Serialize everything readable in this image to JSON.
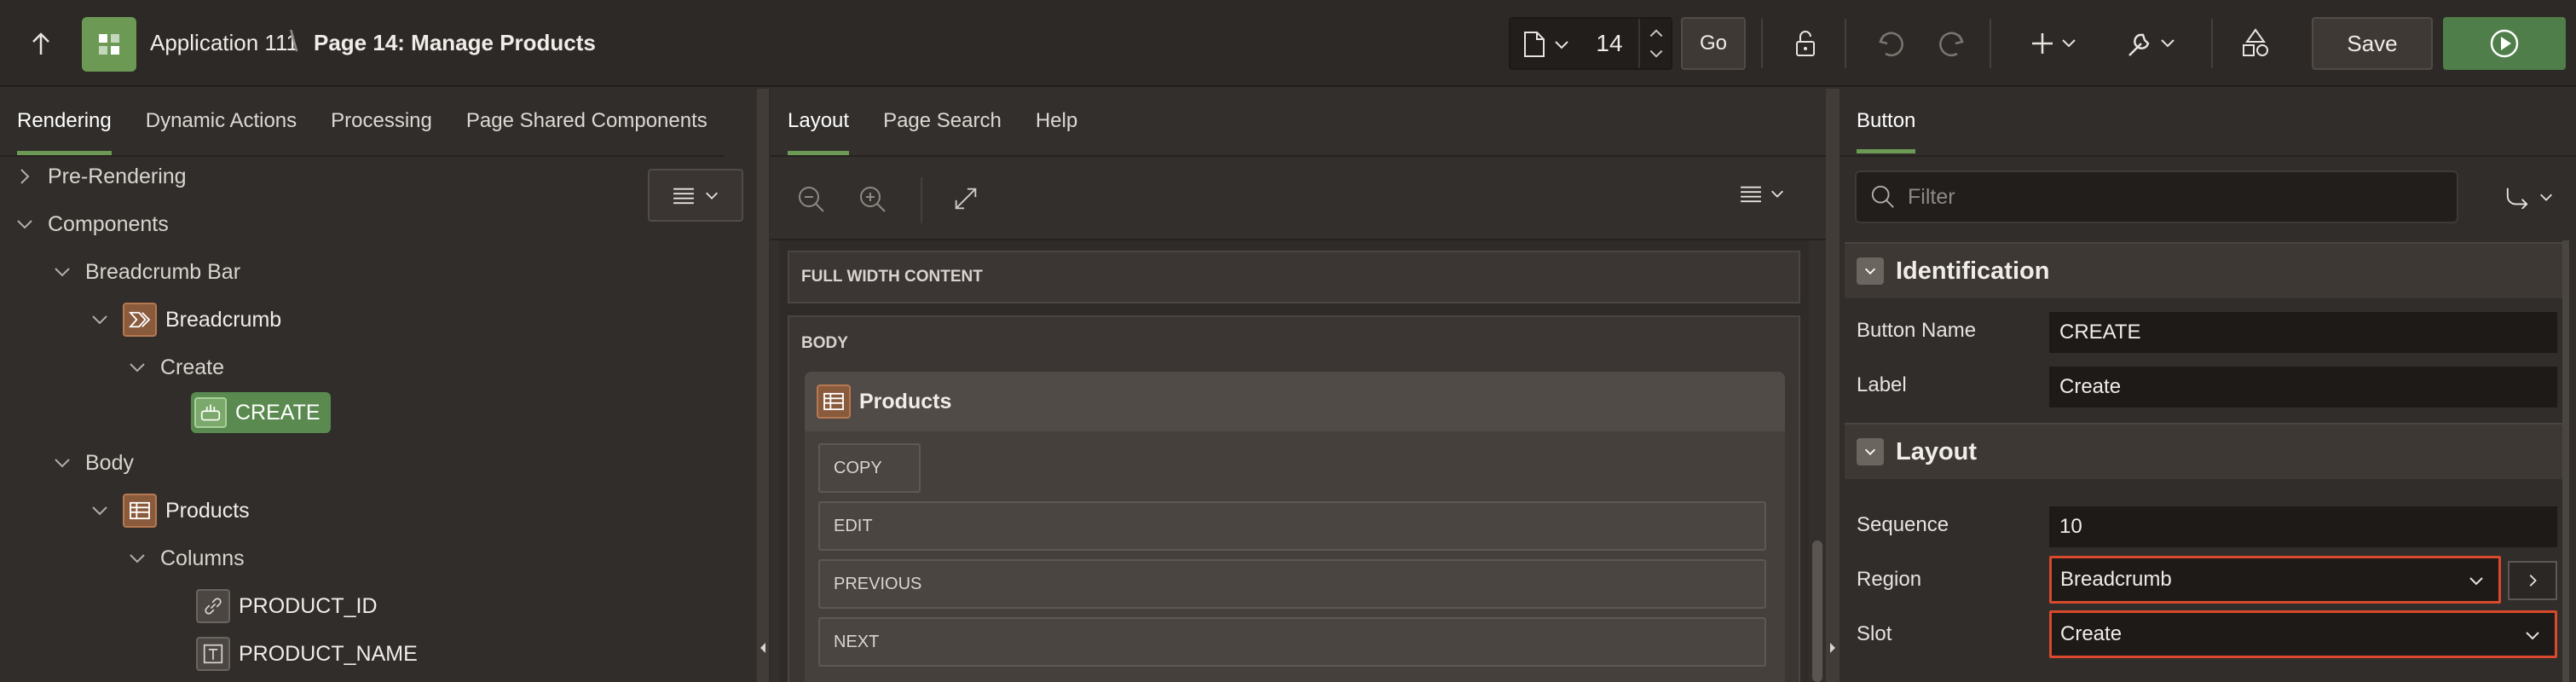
{
  "header": {
    "app_name": "Application 111",
    "separator": "\\",
    "page_title": "Page 14: Manage Products",
    "page_number": "14",
    "go_label": "Go",
    "save_label": "Save"
  },
  "left_panel": {
    "tabs": [
      "Rendering",
      "Dynamic Actions",
      "Processing",
      "Page Shared Components"
    ],
    "active_tab": "Rendering",
    "tree": {
      "pre_rendering": "Pre-Rendering",
      "components": "Components",
      "breadcrumb_bar": "Breadcrumb Bar",
      "breadcrumb": "Breadcrumb",
      "create_slot": "Create",
      "create_button": "CREATE",
      "body": "Body",
      "products": "Products",
      "columns": "Columns",
      "col_product_id": "PRODUCT_ID",
      "col_product_name": "PRODUCT_NAME"
    }
  },
  "center_panel": {
    "tabs": [
      "Layout",
      "Page Search",
      "Help"
    ],
    "active_tab": "Layout",
    "full_width_label": "FULL WIDTH CONTENT",
    "body_label": "BODY",
    "region_title": "Products",
    "buttons": [
      "COPY",
      "EDIT",
      "PREVIOUS",
      "NEXT"
    ]
  },
  "right_panel": {
    "tab": "Button",
    "filter_placeholder": "Filter",
    "sections": {
      "identification": {
        "title": "Identification",
        "button_name_label": "Button Name",
        "button_name_value": "CREATE",
        "label_label": "Label",
        "label_value": "Create"
      },
      "layout": {
        "title": "Layout",
        "sequence_label": "Sequence",
        "sequence_value": "10",
        "region_label": "Region",
        "region_value": "Breadcrumb",
        "slot_label": "Slot",
        "slot_value": "Create"
      }
    }
  },
  "colors": {
    "accent_green": "#6c9a55",
    "run_green": "#4f7e4a",
    "highlight_red": "#d9492b",
    "region_orange": "#8a5a3c"
  },
  "icons": [
    "up-arrow-icon",
    "app-grid-icon",
    "page-icon",
    "undo-icon",
    "redo-icon",
    "plus-icon",
    "wrench-icon",
    "shapes-icon",
    "run-icon",
    "zoom-out-icon",
    "zoom-in-icon",
    "expand-icon",
    "menu-icon",
    "search-icon",
    "goto-icon"
  ]
}
